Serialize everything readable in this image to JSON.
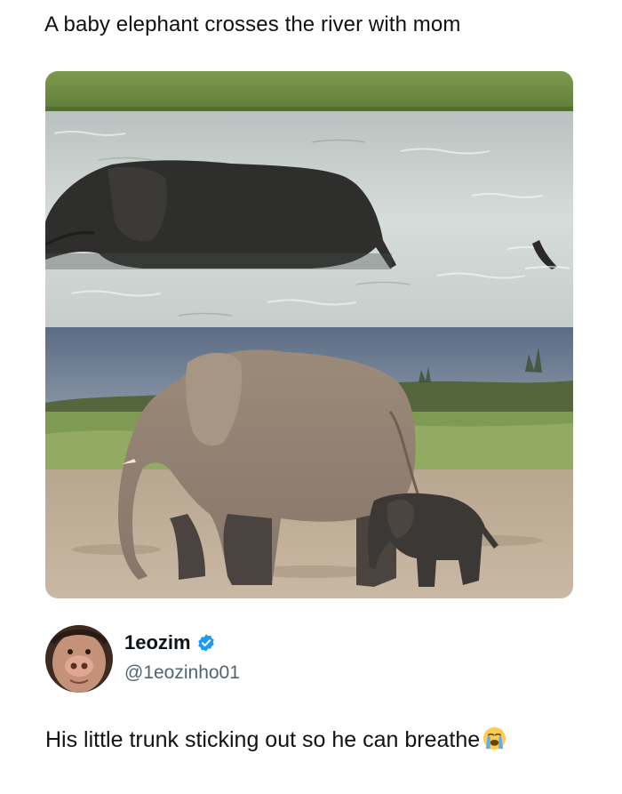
{
  "post": {
    "title": "A baby elephant crosses the river with mom"
  },
  "images": [
    {
      "icon": "elephant-crossing-river-photo"
    },
    {
      "icon": "elephant-mother-and-baby-photo"
    }
  ],
  "tweet": {
    "display_name": "1eozim",
    "handle": "@1eozinho01",
    "verified": true,
    "text": "His little trunk sticking out so he can breathe",
    "emoji": "loudly-crying-face-icon"
  },
  "colors": {
    "verified_blue": "#1d9bf0",
    "handle_gray": "#536471",
    "text": "#0f1419"
  }
}
